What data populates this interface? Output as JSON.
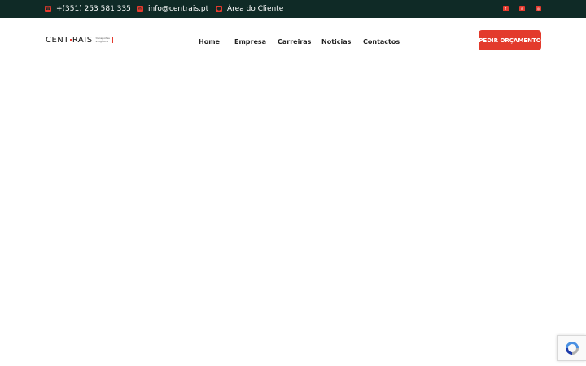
{
  "topbar": {
    "phone": "+(351) 253 581 335",
    "email": "info@centrais.pt",
    "client_area": "Área do Cliente",
    "icons": {
      "phone": "phone-icon",
      "email": "email-icon",
      "client": "user-icon"
    },
    "social": [
      {
        "name": "facebook-icon",
        "glyph": "f"
      },
      {
        "name": "linkedin-icon",
        "glyph": "in"
      },
      {
        "name": "instagram-icon",
        "glyph": "◎"
      }
    ]
  },
  "header": {
    "logo": {
      "word_left": "CENT",
      "word_right": "RAIS",
      "tagline_line1": "transportes",
      "tagline_line2": "e logística"
    },
    "nav": [
      "Home",
      "Empresa",
      "Carreiras",
      "Noticias",
      "Contactos"
    ],
    "cta_label": "PEDIR ORÇAMENTO"
  },
  "colors": {
    "topbar_bg": "#0f2a26",
    "accent": "#e33a2c",
    "text": "#222222"
  }
}
